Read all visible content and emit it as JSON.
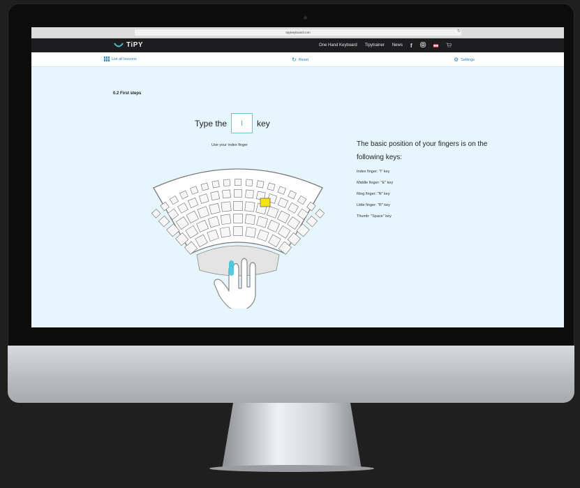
{
  "browser": {
    "url": "tipykeyboard.com"
  },
  "nav": {
    "logo_text": "TiPY",
    "links": [
      "One Hand Keyboard",
      "Tipytrainer",
      "News"
    ],
    "icons": [
      "facebook-icon",
      "instagram-icon",
      "austria-flag-icon",
      "cart-icon"
    ]
  },
  "toolbar": {
    "list_lessons": "List all lessons",
    "reset": "Reset",
    "settings": "Settings"
  },
  "lesson": {
    "title": "0.2 First steps",
    "prompt_before": "Type the",
    "target_key": "I",
    "prompt_after": "key",
    "hint": "Use your index finger"
  },
  "info": {
    "title": "The basic position of your fingers is on the following keys:",
    "items": [
      "Index finger: \"I\" key",
      "Middle finger: \"E\" key",
      "Ring finger: \"N\" key",
      "Little finger: \"R\" key",
      "Thumb: \"Space\" key"
    ]
  },
  "colors": {
    "page_bg": "#e7f5fc",
    "nav_bg": "#1d1d1f",
    "accent": "#2a7fbd",
    "highlight_key": "#f7e30a",
    "finger_glow": "#41c6dd"
  }
}
